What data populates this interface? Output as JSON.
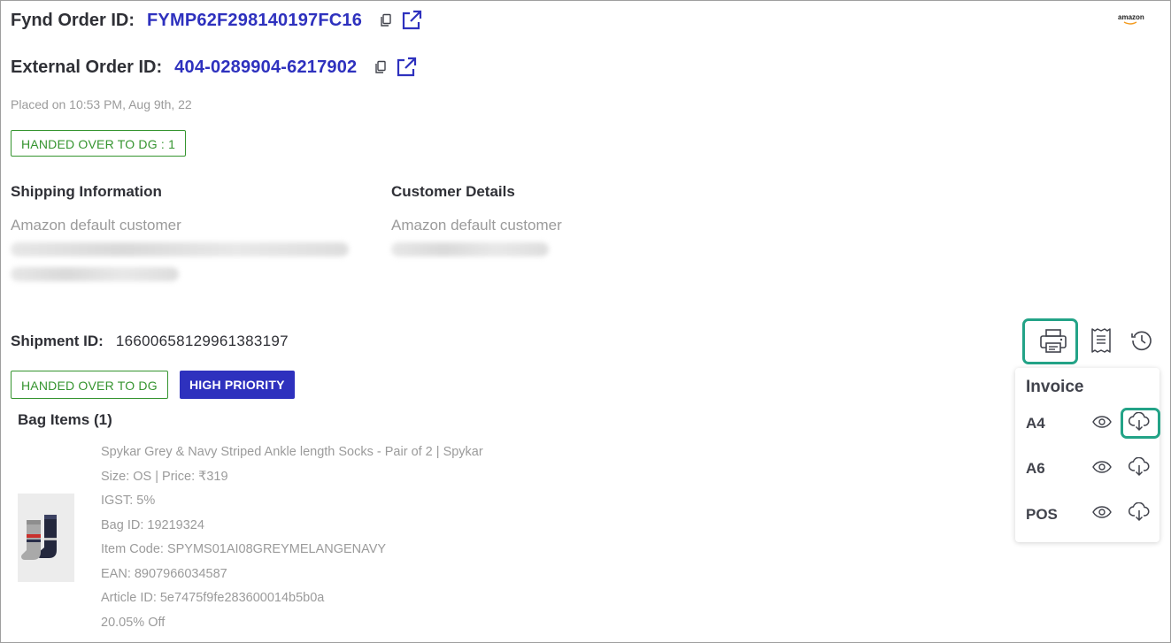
{
  "order": {
    "fynd_label": "Fynd Order ID:",
    "fynd_id": "FYMP62F298140197FC16",
    "external_label": "External Order ID:",
    "external_id": "404-0289904-6217902",
    "placed_on": "Placed on 10:53 PM, Aug 9th, 22",
    "status_badge": "HANDED OVER TO DG : 1",
    "channel_logo_text": "amazon"
  },
  "shipping": {
    "title": "Shipping Information",
    "name": "Amazon default customer"
  },
  "customer": {
    "title": "Customer Details",
    "name": "Amazon default customer"
  },
  "shipment": {
    "label": "Shipment ID:",
    "id": "16600658129961383197",
    "status_badge": "HANDED OVER TO DG",
    "priority_badge": "HIGH PRIORITY"
  },
  "bag": {
    "title": "Bag Items (1)",
    "item": {
      "name": "Spykar Grey & Navy Striped Ankle length Socks - Pair of 2 | Spykar",
      "size_price": "Size: OS | Price: ₹319",
      "igst": "IGST: 5%",
      "bag_id": "Bag ID: 19219324",
      "item_code": "Item Code: SPYMS01AI08GREYMELANGENAVY",
      "ean": "EAN: 8907966034587",
      "article_id": "Article ID: 5e7475f9fe283600014b5b0a",
      "discount": "20.05% Off"
    }
  },
  "invoice_menu": {
    "title": "Invoice",
    "options": [
      "A4",
      "A6",
      "POS"
    ]
  },
  "icons": {
    "copy": "copy-icon",
    "external": "external-link-icon",
    "print": "printer-icon",
    "receipt": "receipt-icon",
    "history": "history-icon",
    "view": "eye-icon",
    "download": "cloud-download-icon"
  },
  "colors": {
    "accent": "#2e31be",
    "status_green": "#35942f",
    "highlight": "#23a387",
    "muted_text": "#9b9b9b"
  }
}
